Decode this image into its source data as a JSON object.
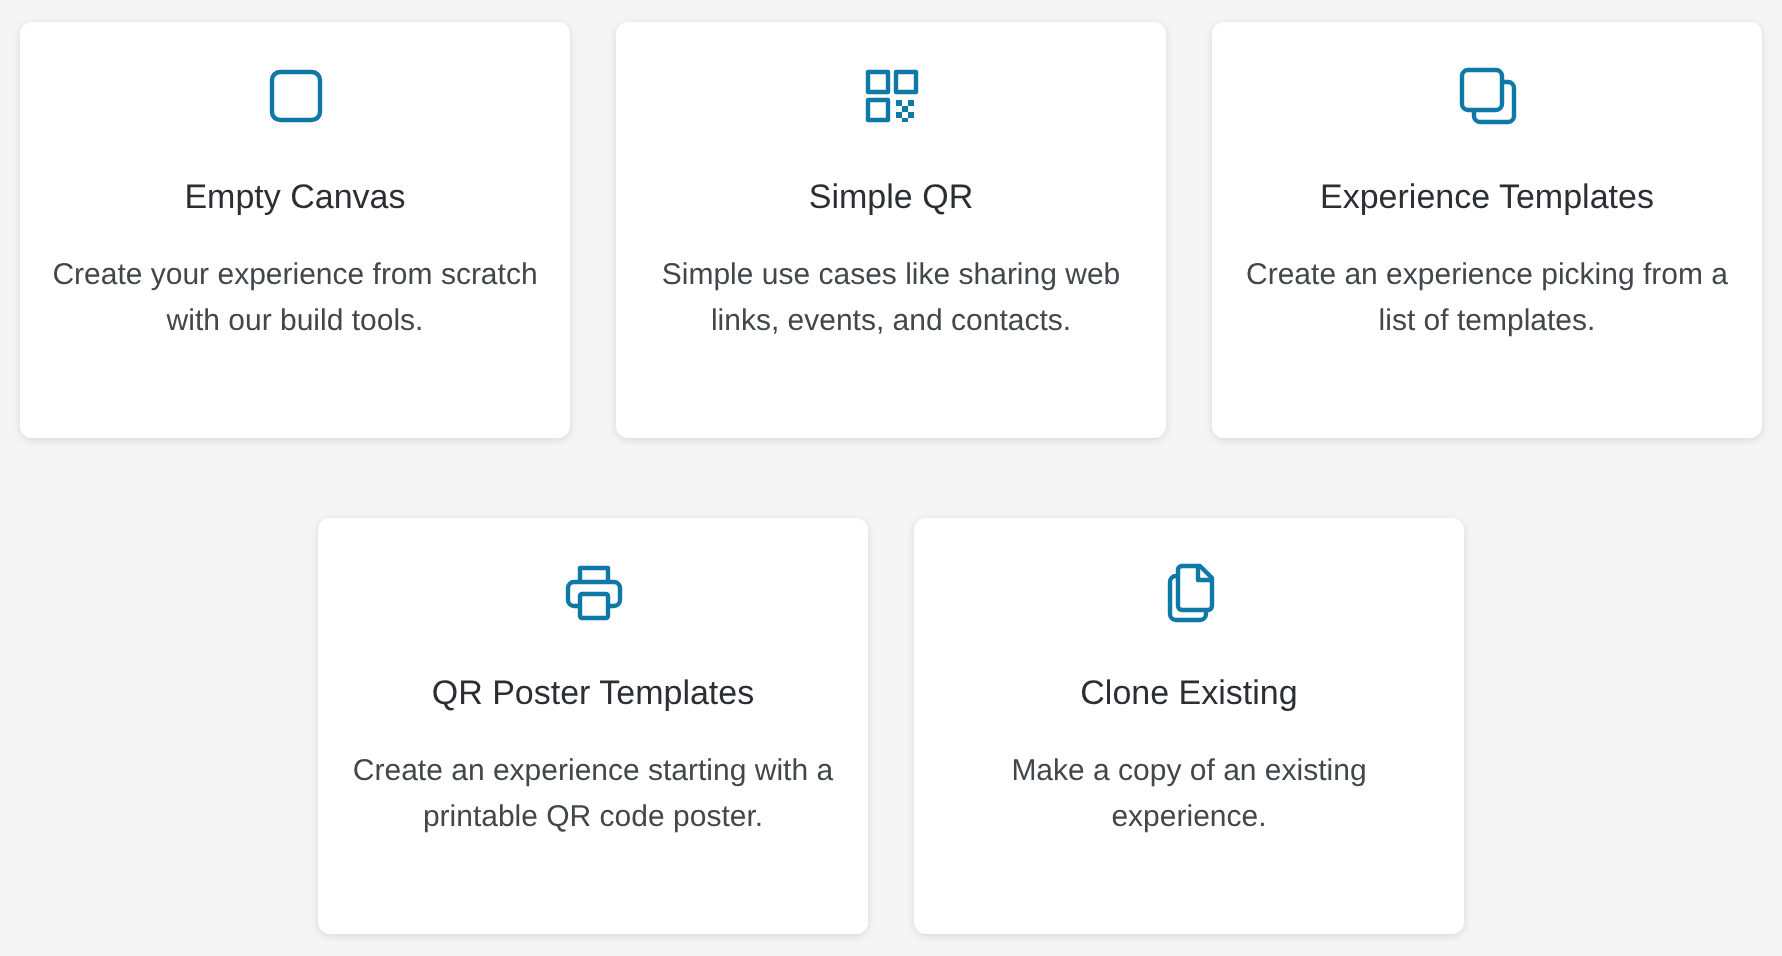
{
  "rows": [
    {
      "cards": [
        {
          "kind": "square",
          "title": "Empty Canvas",
          "description": "Create your experience from scratch with our build tools."
        },
        {
          "kind": "qr",
          "title": "Simple QR",
          "description": "Simple use cases like sharing web links, events, and contacts."
        },
        {
          "kind": "stack",
          "title": "Experience Templates",
          "description": "Create an experience picking from a list of templates."
        }
      ]
    },
    {
      "cards": [
        {
          "kind": "printer",
          "title": "QR Poster Templates",
          "description": "Create an experience starting with a printable QR code poster."
        },
        {
          "kind": "copy",
          "title": "Clone Existing",
          "description": "Make a copy of an existing experience."
        }
      ]
    }
  ]
}
